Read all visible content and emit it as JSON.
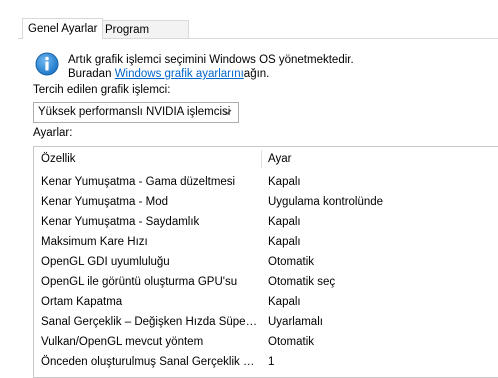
{
  "tabs": [
    "Genel Ayarlar",
    "Program Ayarları"
  ],
  "info": {
    "line1": "Artık grafik işlemci seçimini Windows OS yönetmektedir.",
    "line2_prefix": "Buradan ",
    "line2_link": "Windows grafik ayarlarını",
    "line2_suffix": "ağın."
  },
  "preferred_gpu": {
    "label": "Tercih edilen grafik işlemci:",
    "value": "Yüksek performanslı NVIDIA işlemcisi"
  },
  "settings": {
    "label": "Ayarlar:",
    "columns": [
      "Özellik",
      "Ayar"
    ],
    "rows": [
      {
        "feature": "Kenar Yumuşatma - Gama düzeltmesi",
        "value": "Kapalı"
      },
      {
        "feature": "Kenar Yumuşatma - Mod",
        "value": "Uygulama kontrolünde"
      },
      {
        "feature": "Kenar Yumuşatma - Saydamlık",
        "value": "Kapalı"
      },
      {
        "feature": "Maksimum Kare Hızı",
        "value": "Kapalı"
      },
      {
        "feature": "OpenGL GDI uyumluluğu",
        "value": "Otomatik"
      },
      {
        "feature": "OpenGL ile görüntü oluşturma GPU'su",
        "value": "Otomatik seç"
      },
      {
        "feature": "Ortam Kapatma",
        "value": "Kapalı"
      },
      {
        "feature": "Sanal Gerçeklik – Değişken Hızda Süper Örnekleme",
        "value": "Uyarlamalı"
      },
      {
        "feature": "Vulkan/OpenGL mevcut yöntem",
        "value": "Otomatik"
      },
      {
        "feature": "Önceden oluşturulmuş Sanal Gerçeklik kareleri",
        "value": "1"
      }
    ]
  },
  "colors": {
    "link": "#0066cc",
    "icon": "#1e78c8"
  }
}
